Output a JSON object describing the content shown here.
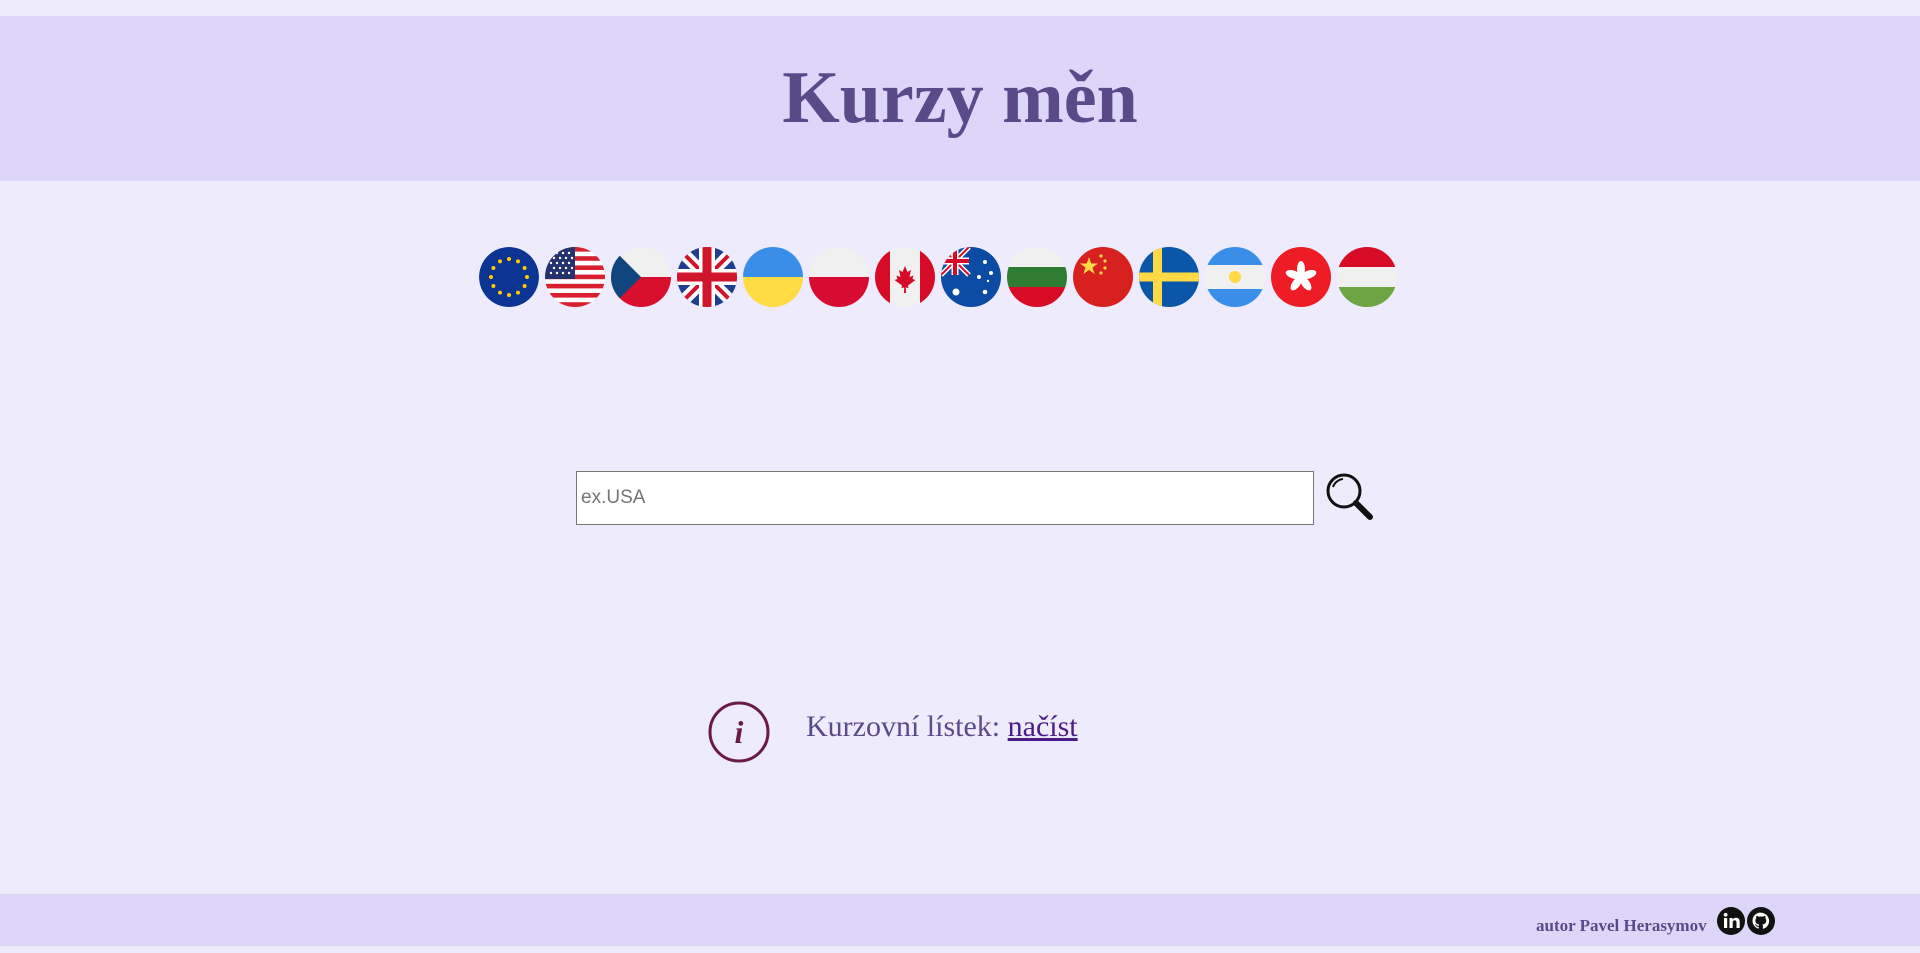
{
  "header": {
    "title": "Kurzy měn"
  },
  "flags": [
    {
      "name": "flag-eu-icon"
    },
    {
      "name": "flag-usa-icon"
    },
    {
      "name": "flag-czech-icon"
    },
    {
      "name": "flag-uk-icon"
    },
    {
      "name": "flag-ukraine-icon"
    },
    {
      "name": "flag-poland-icon"
    },
    {
      "name": "flag-canada-icon"
    },
    {
      "name": "flag-australia-icon"
    },
    {
      "name": "flag-bulgaria-icon"
    },
    {
      "name": "flag-china-icon"
    },
    {
      "name": "flag-sweden-icon"
    },
    {
      "name": "flag-argentina-icon"
    },
    {
      "name": "flag-hongkong-icon"
    },
    {
      "name": "flag-hungary-icon"
    }
  ],
  "search": {
    "placeholder": "ex.USA",
    "value": ""
  },
  "rates": {
    "label": "Kurzovní lístek: ",
    "link": "načíst"
  },
  "footer": {
    "author": "autor Pavel Herasymov",
    "linkedin_icon": "linkedin-icon",
    "github_icon": "github-icon"
  },
  "colors": {
    "page_bg": "#eeebfd",
    "header_bg": "#ddd6f8",
    "title": "#5a4a8a",
    "link": "#4b1c86",
    "info_icon": "#6a1a4a"
  }
}
